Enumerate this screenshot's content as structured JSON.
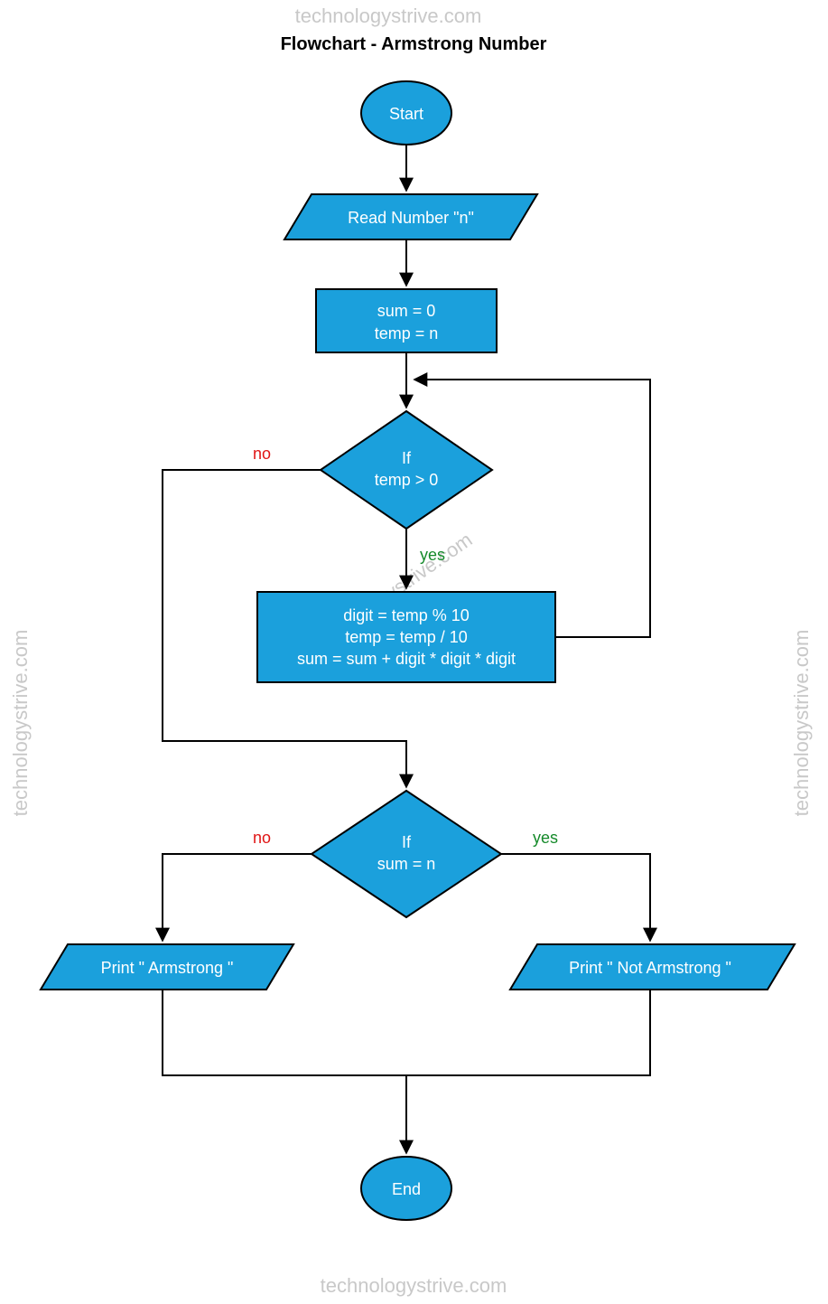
{
  "title": "Flowchart - Armstrong Number",
  "watermark": "technologystrive.com",
  "labels": {
    "yes": "yes",
    "no": "no"
  },
  "nodes": {
    "start": "Start",
    "read": "Read Number \"n\"",
    "init_line1": "sum = 0",
    "init_line2": "temp = n",
    "cond1_line1": "If",
    "cond1_line2": "temp > 0",
    "body_line1": "digit = temp % 10",
    "body_line2": "temp = temp / 10",
    "body_line3": "sum = sum + digit * digit * digit",
    "cond2_line1": "If",
    "cond2_line2": "sum = n",
    "print_yes": "Print \" Armstrong \"",
    "print_no": "Print \" Not Armstrong \"",
    "end": "End"
  },
  "flowchart": {
    "description": "Armstrong number check flowchart",
    "steps": [
      {
        "id": "start",
        "type": "terminator",
        "text": "Start",
        "next": "read"
      },
      {
        "id": "read",
        "type": "io",
        "text": "Read Number \"n\"",
        "next": "init"
      },
      {
        "id": "init",
        "type": "process",
        "text": "sum = 0; temp = n",
        "next": "cond1"
      },
      {
        "id": "cond1",
        "type": "decision",
        "text": "If temp > 0",
        "yes": "body",
        "no": "cond2"
      },
      {
        "id": "body",
        "type": "process",
        "text": "digit = temp % 10; temp = temp / 10; sum = sum + digit * digit * digit",
        "next": "cond1"
      },
      {
        "id": "cond2",
        "type": "decision",
        "text": "If sum = n",
        "yes": "print_no",
        "no": "print_yes"
      },
      {
        "id": "print_yes",
        "type": "io",
        "text": "Print \" Armstrong \"",
        "next": "end"
      },
      {
        "id": "print_no",
        "type": "io",
        "text": "Print \" Not Armstrong \"",
        "next": "end"
      },
      {
        "id": "end",
        "type": "terminator",
        "text": "End"
      }
    ]
  }
}
